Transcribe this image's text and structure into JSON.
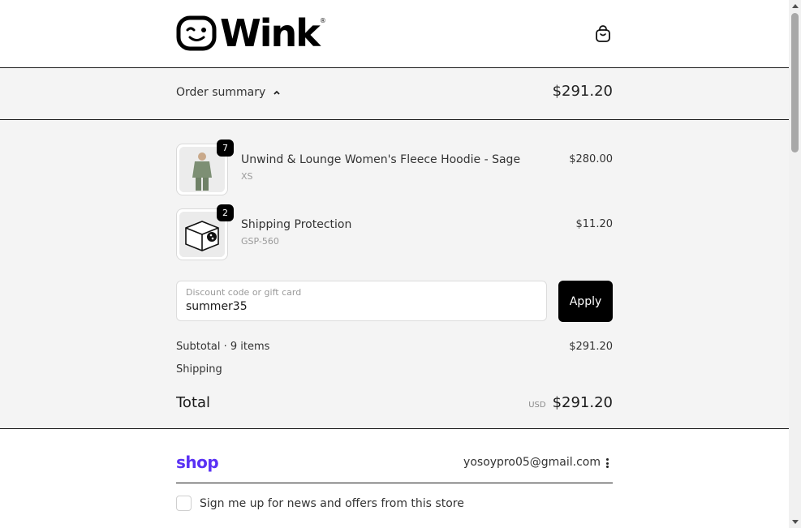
{
  "header": {
    "brand": "Wink",
    "registered_mark": "®",
    "cart_icon": "shopping-bag-icon"
  },
  "summary": {
    "toggle_label": "Order summary",
    "toggle_icon": "chevron-up-icon",
    "total": "$291.20"
  },
  "items": [
    {
      "name": "Unwind & Lounge Women's Fleece Hoodie - Sage",
      "variant": "XS",
      "price": "$280.00",
      "quantity": "7"
    },
    {
      "name": "Shipping Protection",
      "variant": "GSP-560",
      "price": "$11.20",
      "quantity": "2"
    }
  ],
  "discount": {
    "label": "Discount code or gift card",
    "value": "summer35",
    "apply_label": "Apply"
  },
  "totals": {
    "subtotal_label": "Subtotal · 9 items",
    "subtotal_value": "$291.20",
    "shipping_label": "Shipping",
    "total_label": "Total",
    "currency": "USD",
    "total_value": "$291.20"
  },
  "shop": {
    "logo": "shop",
    "email": "yosoypro05@gmail.com",
    "newsletter_label": "Sign me up for news and offers from this store"
  },
  "colors": {
    "accent": "#000000",
    "shop_purple": "#5a31f4",
    "panel_bg": "#f4f4f4"
  }
}
